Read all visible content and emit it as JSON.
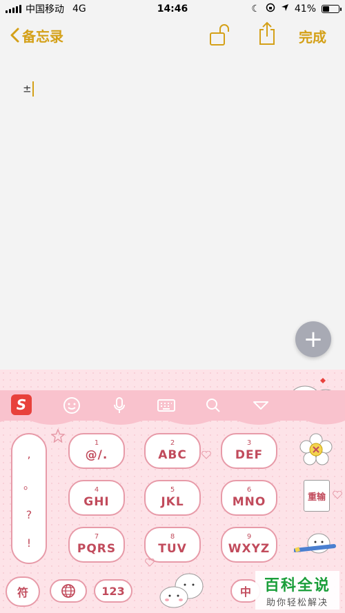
{
  "status_bar": {
    "carrier": "中国移动",
    "network": "4G",
    "time": "14:46",
    "battery_percent": "41%",
    "battery_level": 0.41
  },
  "nav": {
    "back_label": "备忘录",
    "done_label": "完成"
  },
  "note": {
    "text": "±"
  },
  "fab": {
    "label": "+"
  },
  "keyboard": {
    "logo": "S",
    "symbols": [
      ",",
      "。",
      "?",
      "!"
    ],
    "keys": [
      {
        "num": "1",
        "letters": "@/."
      },
      {
        "num": "2",
        "letters": "ABC"
      },
      {
        "num": "3",
        "letters": "DEF"
      },
      {
        "num": "4",
        "letters": "GHI"
      },
      {
        "num": "5",
        "letters": "JKL"
      },
      {
        "num": "6",
        "letters": "MNO"
      },
      {
        "num": "7",
        "letters": "PQRS"
      },
      {
        "num": "8",
        "letters": "TUV"
      },
      {
        "num": "9",
        "letters": "WXYZ"
      }
    ],
    "bottom": {
      "symbol_key": "符",
      "num_key": "123",
      "lang_key": "中"
    },
    "side_stamp": "重输"
  },
  "watermark": {
    "title": "百科全说",
    "subtitle": "助你轻松解决"
  },
  "colors": {
    "accent": "#d4a017",
    "keyboard_bg": "#fde3e8",
    "key_border": "#e79aa8",
    "key_text": "#c14b5c"
  }
}
